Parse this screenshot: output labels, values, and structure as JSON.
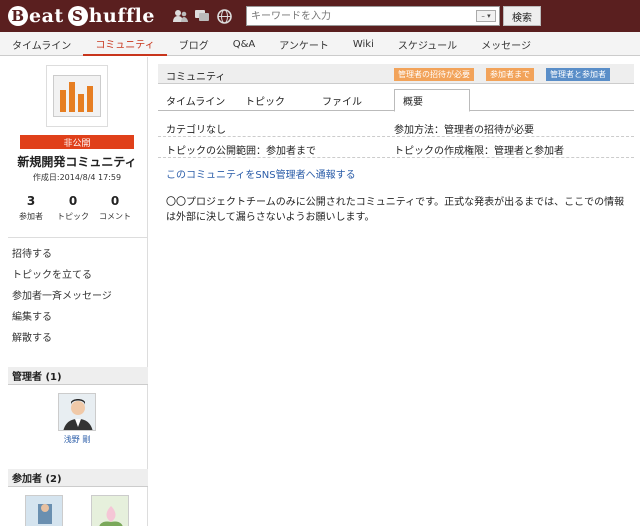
{
  "header": {
    "logo_part1": "eat",
    "logo_b": "B",
    "logo_part2_s": "S",
    "logo_part2": "huffle",
    "search_placeholder": "キーワードを入力",
    "search_button": "検索",
    "icons": [
      "users-icon",
      "chat-icon",
      "globe-icon"
    ]
  },
  "nav": {
    "items": [
      {
        "label": "タイムライン"
      },
      {
        "label": "コミュニティ"
      },
      {
        "label": "ブログ"
      },
      {
        "label": "Q&A"
      },
      {
        "label": "アンケート"
      },
      {
        "label": "Wiki"
      },
      {
        "label": "スケジュール"
      },
      {
        "label": "メッセージ"
      }
    ],
    "active": "コミュニティ"
  },
  "sidebar": {
    "badge": "非公開",
    "name": "新規開発コミュニティ",
    "created": "作成日:2014/8/4 17:59",
    "stats": [
      {
        "num": "3",
        "label": "参加者"
      },
      {
        "num": "0",
        "label": "トピック"
      },
      {
        "num": "0",
        "label": "コメント"
      }
    ],
    "actions": [
      "招待する",
      "トピックを立てる",
      "参加者一斉メッセージ",
      "編集する",
      "解散する"
    ],
    "admins_header": "管理者 (1)",
    "admin_name": "浅野 剛",
    "members_header": "参加者 (2)"
  },
  "main": {
    "title": "コミュニティ",
    "badges": [
      "管理者の招待が必要",
      "参加者まで",
      "管理者と参加者"
    ],
    "tabs": [
      "タイムライン",
      "トピック",
      "ファイル",
      "概要"
    ],
    "info": {
      "category": "カテゴリなし",
      "join": "参加方法：管理者の招待が必要",
      "topic_scope": "トピックの公開範囲：参加者まで",
      "topic_perm": "トピックの作成権限：管理者と参加者"
    },
    "report_link": "このコミュニティをSNS管理者へ通報する",
    "description": "〇〇プロジェクトチームのみに公開されたコミュニティです。正式な発表が出るまでは、ここでの情報は外部に決して漏らさないようお願いします。"
  },
  "colors": {
    "header_bg": "#5a1f1f",
    "accent": "#c8351c",
    "badge_orange": "#f2a35a",
    "badge_blue": "#5a8ec8",
    "link": "#2a5ca8"
  }
}
